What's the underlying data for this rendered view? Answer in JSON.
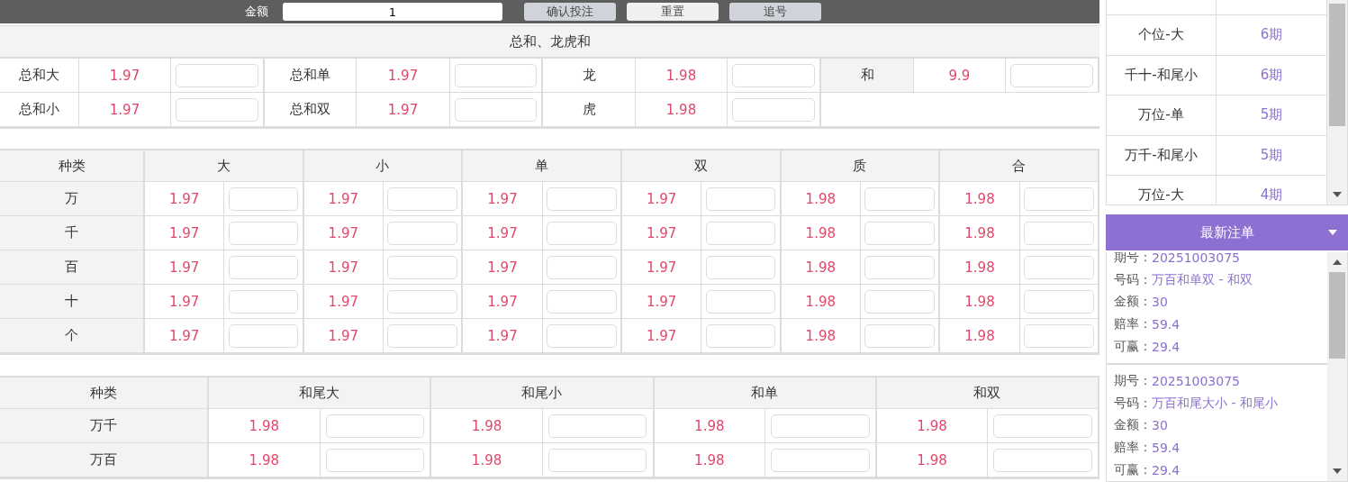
{
  "top_bar": {
    "amount_label": "金额",
    "amount_value": "1",
    "buttons": [
      {
        "label": "确认投注",
        "kind": "primary"
      },
      {
        "label": "重置",
        "kind": "plain"
      },
      {
        "label": "追号",
        "kind": "primary"
      }
    ]
  },
  "sum_section": {
    "title": "总和、龙虎和",
    "rows": [
      [
        {
          "label": "总和大",
          "odds": "1.97"
        },
        {
          "label": "总和单",
          "odds": "1.97"
        },
        {
          "label": "龙",
          "odds": "1.98"
        },
        {
          "label": "和",
          "odds": "9.9"
        }
      ],
      [
        {
          "label": "总和小",
          "odds": "1.97"
        },
        {
          "label": "总和双",
          "odds": "1.97"
        },
        {
          "label": "虎",
          "odds": "1.98"
        }
      ]
    ]
  },
  "position_table": {
    "columns": [
      "种类",
      "大",
      "小",
      "单",
      "双",
      "质",
      "合"
    ],
    "rows": [
      {
        "name": "万",
        "odds": [
          "1.97",
          "1.97",
          "1.97",
          "1.97",
          "1.98",
          "1.98"
        ]
      },
      {
        "name": "千",
        "odds": [
          "1.97",
          "1.97",
          "1.97",
          "1.97",
          "1.98",
          "1.98"
        ]
      },
      {
        "name": "百",
        "odds": [
          "1.97",
          "1.97",
          "1.97",
          "1.97",
          "1.98",
          "1.98"
        ]
      },
      {
        "name": "十",
        "odds": [
          "1.97",
          "1.97",
          "1.97",
          "1.97",
          "1.98",
          "1.98"
        ]
      },
      {
        "name": "个",
        "odds": [
          "1.97",
          "1.97",
          "1.97",
          "1.97",
          "1.98",
          "1.98"
        ]
      }
    ]
  },
  "pair_table": {
    "columns": [
      "种类",
      "和尾大",
      "和尾小",
      "和单",
      "和双"
    ],
    "rows": [
      {
        "name": "万千",
        "odds": [
          "1.98",
          "1.98",
          "1.98",
          "1.98"
        ]
      },
      {
        "name": "万百",
        "odds": [
          "1.98",
          "1.98",
          "1.98",
          "1.98"
        ]
      }
    ]
  },
  "streak_panel": {
    "rows": [
      {
        "name": "个位-大",
        "count": "6期"
      },
      {
        "name": "千十-和尾小",
        "count": "6期"
      },
      {
        "name": "万位-单",
        "count": "5期"
      },
      {
        "name": "万千-和尾小",
        "count": "5期"
      },
      {
        "name": "万位-大",
        "count": "4期"
      }
    ]
  },
  "latest_bets": {
    "title": "最新注单",
    "entries": [
      {
        "fields": [
          {
            "label": "期号：",
            "value": "20251003075"
          },
          {
            "label": "号码：",
            "value": "万百和单双 - 和双"
          },
          {
            "label": "金额：",
            "value": "30"
          },
          {
            "label": "赔率：",
            "value": "59.4"
          },
          {
            "label": "可赢：",
            "value": "29.4"
          }
        ]
      },
      {
        "fields": [
          {
            "label": "期号：",
            "value": "20251003075"
          },
          {
            "label": "号码：",
            "value": "万百和尾大小 - 和尾小"
          },
          {
            "label": "金额：",
            "value": "30"
          },
          {
            "label": "赔率：",
            "value": "59.4"
          },
          {
            "label": "可赢：",
            "value": "29.4"
          }
        ]
      }
    ]
  }
}
